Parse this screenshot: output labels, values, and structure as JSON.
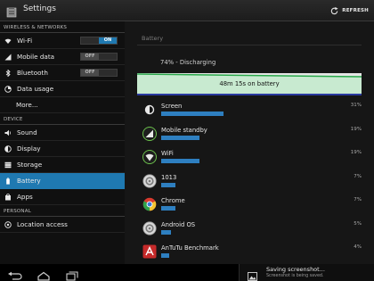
{
  "actionbar": {
    "title": "Settings",
    "refresh_label": "REFRESH"
  },
  "sidebar": {
    "sections": [
      {
        "header": "WIRELESS & NETWORKS",
        "items": [
          {
            "label": "Wi-Fi",
            "icon": "wifi-icon",
            "toggle": "ON"
          },
          {
            "label": "Mobile data",
            "icon": "mobile-data-icon",
            "toggle": "OFF"
          },
          {
            "label": "Bluetooth",
            "icon": "bluetooth-icon",
            "toggle": "OFF"
          },
          {
            "label": "Data usage",
            "icon": "data-usage-icon"
          },
          {
            "label": "More..."
          }
        ]
      },
      {
        "header": "DEVICE",
        "items": [
          {
            "label": "Sound",
            "icon": "sound-icon"
          },
          {
            "label": "Display",
            "icon": "display-icon"
          },
          {
            "label": "Storage",
            "icon": "storage-icon"
          },
          {
            "label": "Battery",
            "icon": "battery-icon",
            "selected": true
          },
          {
            "label": "Apps",
            "icon": "apps-icon"
          }
        ]
      },
      {
        "header": "PERSONAL",
        "items": [
          {
            "label": "Location access",
            "icon": "location-icon"
          }
        ]
      }
    ]
  },
  "battery": {
    "title": "Battery",
    "status": "74% - Discharging",
    "graph_label": "48m 15s on battery",
    "graph_color": "#2a3aa0",
    "usage": [
      {
        "name": "Screen",
        "percent": "31%",
        "value": 31,
        "icon": "screen-icon"
      },
      {
        "name": "Mobile standby",
        "percent": "19%",
        "value": 19,
        "icon": "mobile-standby-icon"
      },
      {
        "name": "WiFi",
        "percent": "19%",
        "value": 19,
        "icon": "wifi-usage-icon"
      },
      {
        "name": "1013",
        "percent": "7%",
        "value": 7,
        "icon": "android-system-icon"
      },
      {
        "name": "Chrome",
        "percent": "7%",
        "value": 7,
        "icon": "chrome-icon"
      },
      {
        "name": "Android OS",
        "percent": "5%",
        "value": 5,
        "icon": "android-os-icon"
      },
      {
        "name": "AnTuTu Benchmark",
        "percent": "4%",
        "value": 4,
        "icon": "antutu-icon"
      }
    ],
    "bar_color": "#2e7fc0"
  },
  "notification": {
    "title": "Saving screenshot...",
    "subtitle": "Screenshot is being saved."
  },
  "colors": {
    "accent": "#1f79b1"
  }
}
